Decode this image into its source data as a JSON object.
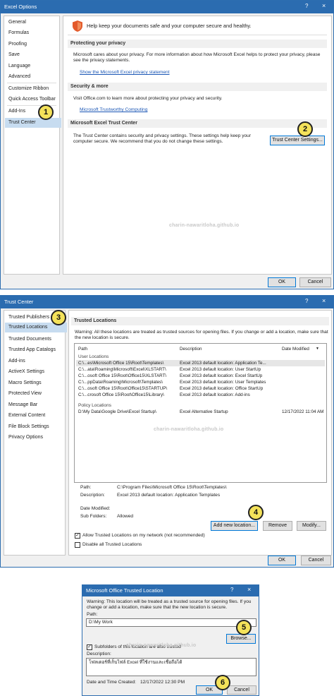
{
  "excel_options": {
    "title": "Excel Options",
    "help": "?",
    "close": "×",
    "nav": [
      "General",
      "Formulas",
      "Proofing",
      "Save",
      "Language",
      "Advanced",
      "Customize Ribbon",
      "Quick Access Toolbar",
      "Add-Ins",
      "Trust Center"
    ],
    "selected_nav": "Trust Center",
    "header": "Help keep your documents safe and your computer secure and healthy.",
    "privacy_section": "Protecting your privacy",
    "privacy_text": "Microsoft cares about your privacy. For more information about how Microsoft Excel helps to protect your privacy, please see the privacy statements.",
    "privacy_link": "Show the Microsoft Excel privacy statement",
    "security_section": "Security & more",
    "security_text": "Visit Office.com to learn more about protecting your privacy and security.",
    "security_link": "Microsoft Trustworthy Computing",
    "trust_section": "Microsoft Excel Trust Center",
    "trust_text": "The Trust Center contains security and privacy settings. These settings help keep your computer secure. We recommend that you do not change these settings.",
    "trust_button": "Trust Center Settings...",
    "ok": "OK",
    "cancel": "Cancel",
    "watermark": "charin-nawaritloha.github.io"
  },
  "trust_center": {
    "title": "Trust Center",
    "help": "?",
    "close": "×",
    "nav": [
      "Trusted Publishers",
      "Trusted Locations",
      "Trusted Documents",
      "Trusted App Catalogs",
      "Add-ins",
      "ActiveX Settings",
      "Macro Settings",
      "Protected View",
      "Message Bar",
      "External Content",
      "File Block Settings",
      "Privacy Options"
    ],
    "selected_nav": "Trusted Locations",
    "section": "Trusted Locations",
    "warning": "Warning: All these locations are treated as trusted sources for opening files.  If you change or add a location, make sure that the new location is secure.",
    "columns": {
      "path": "Path",
      "description": "Description",
      "date": "Date Modified"
    },
    "user_group": "User Locations",
    "user_rows": [
      {
        "path": "C:\\...es\\Microsoft Office 15\\Root\\Templates\\",
        "desc": "Excel 2013 default location: Application Te...",
        "date": ""
      },
      {
        "path": "C:\\...ata\\Roaming\\Microsoft\\Excel\\XLSTART\\",
        "desc": "Excel 2013 default location: User StartUp",
        "date": ""
      },
      {
        "path": "C:\\...osoft Office 15\\Root\\Office15\\XLSTART\\",
        "desc": "Excel 2013 default location: Excel StartUp",
        "date": ""
      },
      {
        "path": "C:\\...ppData\\Roaming\\Microsoft\\Templates\\",
        "desc": "Excel 2013 default location: User Templates",
        "date": ""
      },
      {
        "path": "C:\\...osoft Office 15\\Root\\Office15\\STARTUP\\",
        "desc": "Excel 2013 default location: Office StartUp",
        "date": ""
      },
      {
        "path": "C:\\...crosoft Office 15\\Root\\Office15\\Library\\",
        "desc": "Excel 2013 default location: Add-ins",
        "date": ""
      }
    ],
    "policy_group": "Policy Locations",
    "policy_rows": [
      {
        "path": "D:\\My Data\\Google Drive\\Excel Startup\\",
        "desc": "Excel Alternative Startup",
        "date": "12/17/2022 11:04 AM"
      }
    ],
    "details": {
      "path_label": "Path:",
      "path_value": "C:\\Program Files\\Microsoft Office 15\\Root\\Templates\\",
      "desc_label": "Description:",
      "desc_value": "Excel 2013 default location: Application Templates",
      "date_label": "Date Modified:",
      "date_value": "",
      "sub_label": "Sub Folders:",
      "sub_value": "Allowed"
    },
    "add_button": "Add new location...",
    "remove_button": "Remove",
    "modify_button": "Modify...",
    "allow_network": "Allow Trusted Locations on my network (not recommended)",
    "allow_network_checked": true,
    "disable_all": "Disable all Trusted Locations",
    "disable_all_checked": false,
    "ok": "OK",
    "cancel": "Cancel"
  },
  "trusted_location": {
    "title": "Microsoft Office Trusted Location",
    "help": "?",
    "close": "×",
    "warning": "Warning: This location will be treated as a trusted source for opening files. If you change or add a location, make sure that the new location is secure.",
    "path_label": "Path:",
    "path_value": "D:\\My Work",
    "browse_button": "Browse...",
    "subfolders_label": "Subfolders of this location are also trusted",
    "subfolders_checked": true,
    "desc_label": "Description:",
    "desc_value": "โฟลเดอร์ที่เก็บไฟล์ Excel ที่ใช้งานและเชื่อถือได้",
    "date_label": "Date and Time Created:",
    "date_value": "12/17/2022 12:30 PM",
    "ok": "OK",
    "cancel": "Cancel"
  },
  "callouts": [
    "1",
    "2",
    "3",
    "4",
    "5",
    "6"
  ],
  "colors": {
    "titlebar": "#2b6cb0",
    "callout": "#f4e25a",
    "selected": "#c7dcf0",
    "link": "#1a56b5"
  }
}
